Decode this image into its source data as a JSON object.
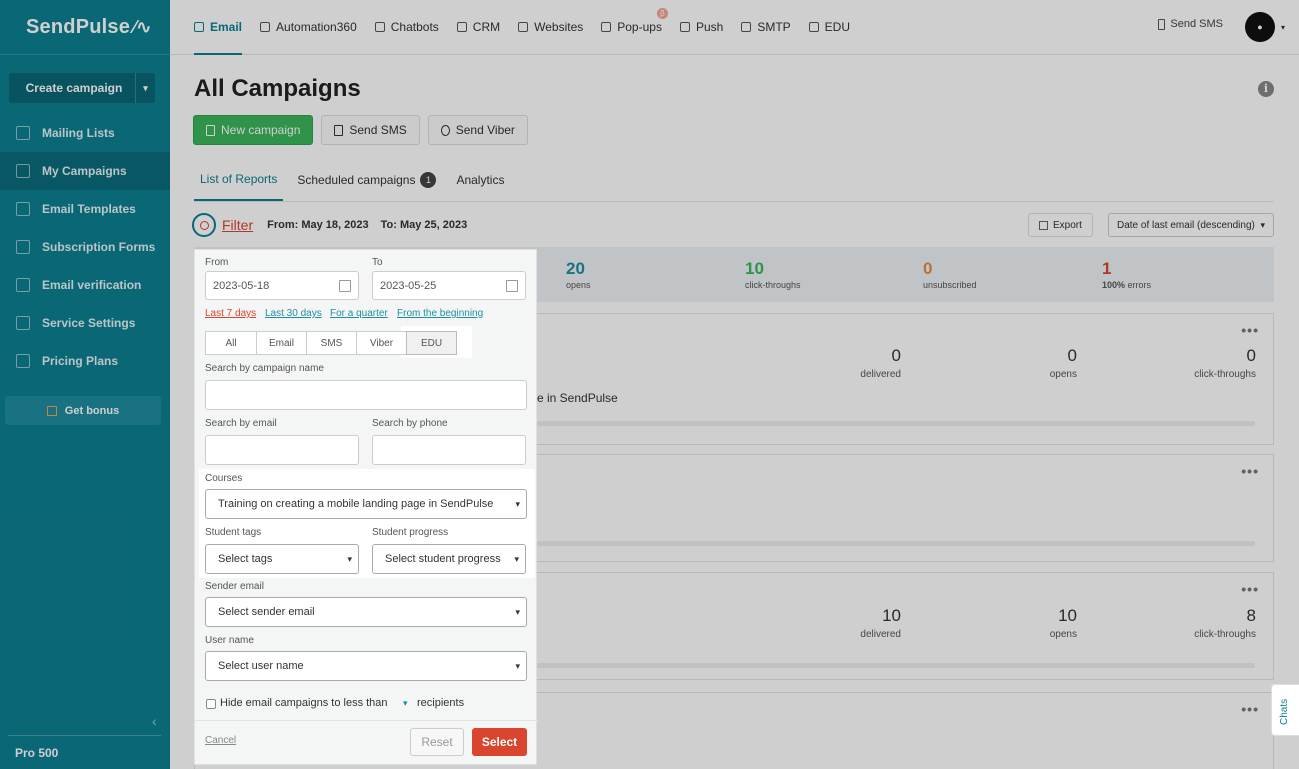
{
  "sidebar": {
    "logo": "SendPulse",
    "create_campaign": "Create campaign",
    "items": [
      {
        "label": "Mailing Lists",
        "icon": "list-icon"
      },
      {
        "label": "My Campaigns",
        "icon": "campaign-icon"
      },
      {
        "label": "Email Templates",
        "icon": "template-icon"
      },
      {
        "label": "Subscription Forms",
        "icon": "form-icon"
      },
      {
        "label": "Email verification",
        "icon": "check-icon"
      },
      {
        "label": "Service Settings",
        "icon": "settings-icon"
      },
      {
        "label": "Pricing Plans",
        "icon": "pricing-icon"
      }
    ],
    "get_bonus": "Get bonus",
    "plan": "Pro 500"
  },
  "topnav": {
    "items": [
      "Email",
      "Automation360",
      "Chatbots",
      "CRM",
      "Websites",
      "Pop-ups",
      "Push",
      "SMTP",
      "EDU"
    ],
    "beta_badge": "β",
    "send_sms": "Send SMS"
  },
  "main": {
    "title": "All Campaigns",
    "buttons": {
      "new_campaign": "New campaign",
      "send_sms": "Send SMS",
      "send_viber": "Send Viber"
    },
    "tabs": [
      {
        "label": "List of Reports"
      },
      {
        "label": "Scheduled campaigns",
        "count": "1"
      },
      {
        "label": "Analytics"
      }
    ],
    "filter": {
      "label": "Filter",
      "from": "From: May 18, 2023",
      "to": "To: May 25, 2023"
    },
    "export": "Export",
    "sort": "Date of last email (descending)",
    "stats": [
      {
        "value": "20",
        "label": "opens",
        "color": "#1e8fa2"
      },
      {
        "value": "10",
        "label": "click-throughs",
        "color": "#3bb55a"
      },
      {
        "value": "0",
        "label": "unsubscribed",
        "color": "#e98a3f"
      },
      {
        "value": "1",
        "bold": "100%",
        "label": "errors",
        "color": "#d9452e"
      }
    ],
    "card1": {
      "delivered": "0",
      "opens": "0",
      "clicks": "0",
      "fragment": "e in SendPulse"
    },
    "card3": {
      "delivered": "10",
      "opens": "10",
      "clicks": "8"
    },
    "labels": {
      "delivered": "delivered",
      "opens": "opens",
      "clicks": "click-throughs"
    }
  },
  "filter_panel": {
    "from_label": "From",
    "from_value": "2023-05-18",
    "to_label": "To",
    "to_value": "2023-05-25",
    "quick": [
      "Last 7 days",
      "Last 30 days",
      "For a quarter",
      "From the beginning"
    ],
    "types": [
      "All",
      "Email",
      "SMS",
      "Viber",
      "EDU"
    ],
    "campaign_name_label": "Search by campaign name",
    "email_label": "Search by email",
    "phone_label": "Search by phone",
    "courses_label": "Courses",
    "courses_value": "Training on creating a mobile landing page in SendPulse",
    "tags_label": "Student tags",
    "tags_value": "Select tags",
    "progress_label": "Student progress",
    "progress_value": "Select student progress",
    "sender_label": "Sender email",
    "sender_value": "Select sender email",
    "user_label": "User name",
    "user_value": "Select user name",
    "hide_text": "Hide email campaigns to less than",
    "recipients": "recipients",
    "cancel": "Cancel",
    "reset": "Reset",
    "select": "Select"
  },
  "chats": "Chats"
}
